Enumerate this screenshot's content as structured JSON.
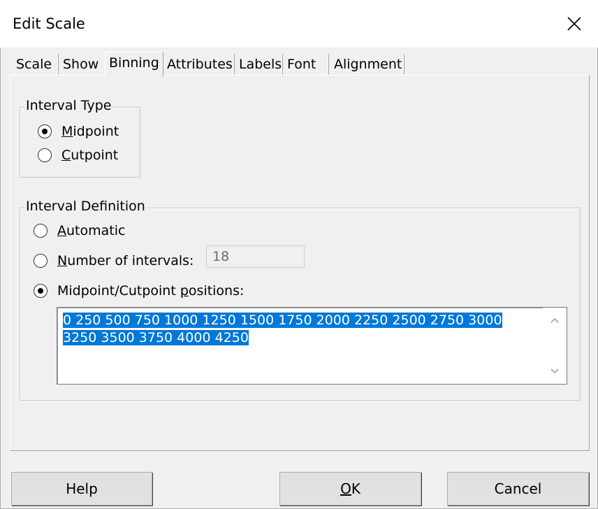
{
  "window": {
    "title": "Edit Scale"
  },
  "tabs": [
    {
      "label": "Scale"
    },
    {
      "label": "Show"
    },
    {
      "label": "Binning",
      "active": true
    },
    {
      "label": "Attributes"
    },
    {
      "label": "Labels"
    },
    {
      "label": "Font"
    },
    {
      "label": "Alignment"
    }
  ],
  "interval_type": {
    "legend": "Interval Type",
    "options": [
      {
        "label_first": "M",
        "label_rest": "idpoint",
        "checked": true
      },
      {
        "label_first": "C",
        "label_rest": "utpoint",
        "checked": false
      }
    ]
  },
  "interval_definition": {
    "legend": "Interval Definition",
    "automatic": {
      "label_first": "A",
      "label_rest": "utomatic",
      "checked": false
    },
    "number_of_intervals": {
      "label_first": "N",
      "label_rest": "umber of intervals:",
      "checked": false,
      "value": "18"
    },
    "positions": {
      "label_before": "Midpoint/Cutpoint ",
      "label_u": "p",
      "label_after": "ositions:",
      "checked": true
    },
    "positions_value": "0 250 500 750 1000 1250 1500 1750 2000 2250 2500 2750 3000 3250 3500 3750 4000 4250"
  },
  "buttons": {
    "help": "Help",
    "ok_first": "O",
    "ok_rest": "K",
    "cancel": "Cancel"
  },
  "colors": {
    "selection": "#0078d7",
    "background": "#f0f0f0"
  }
}
